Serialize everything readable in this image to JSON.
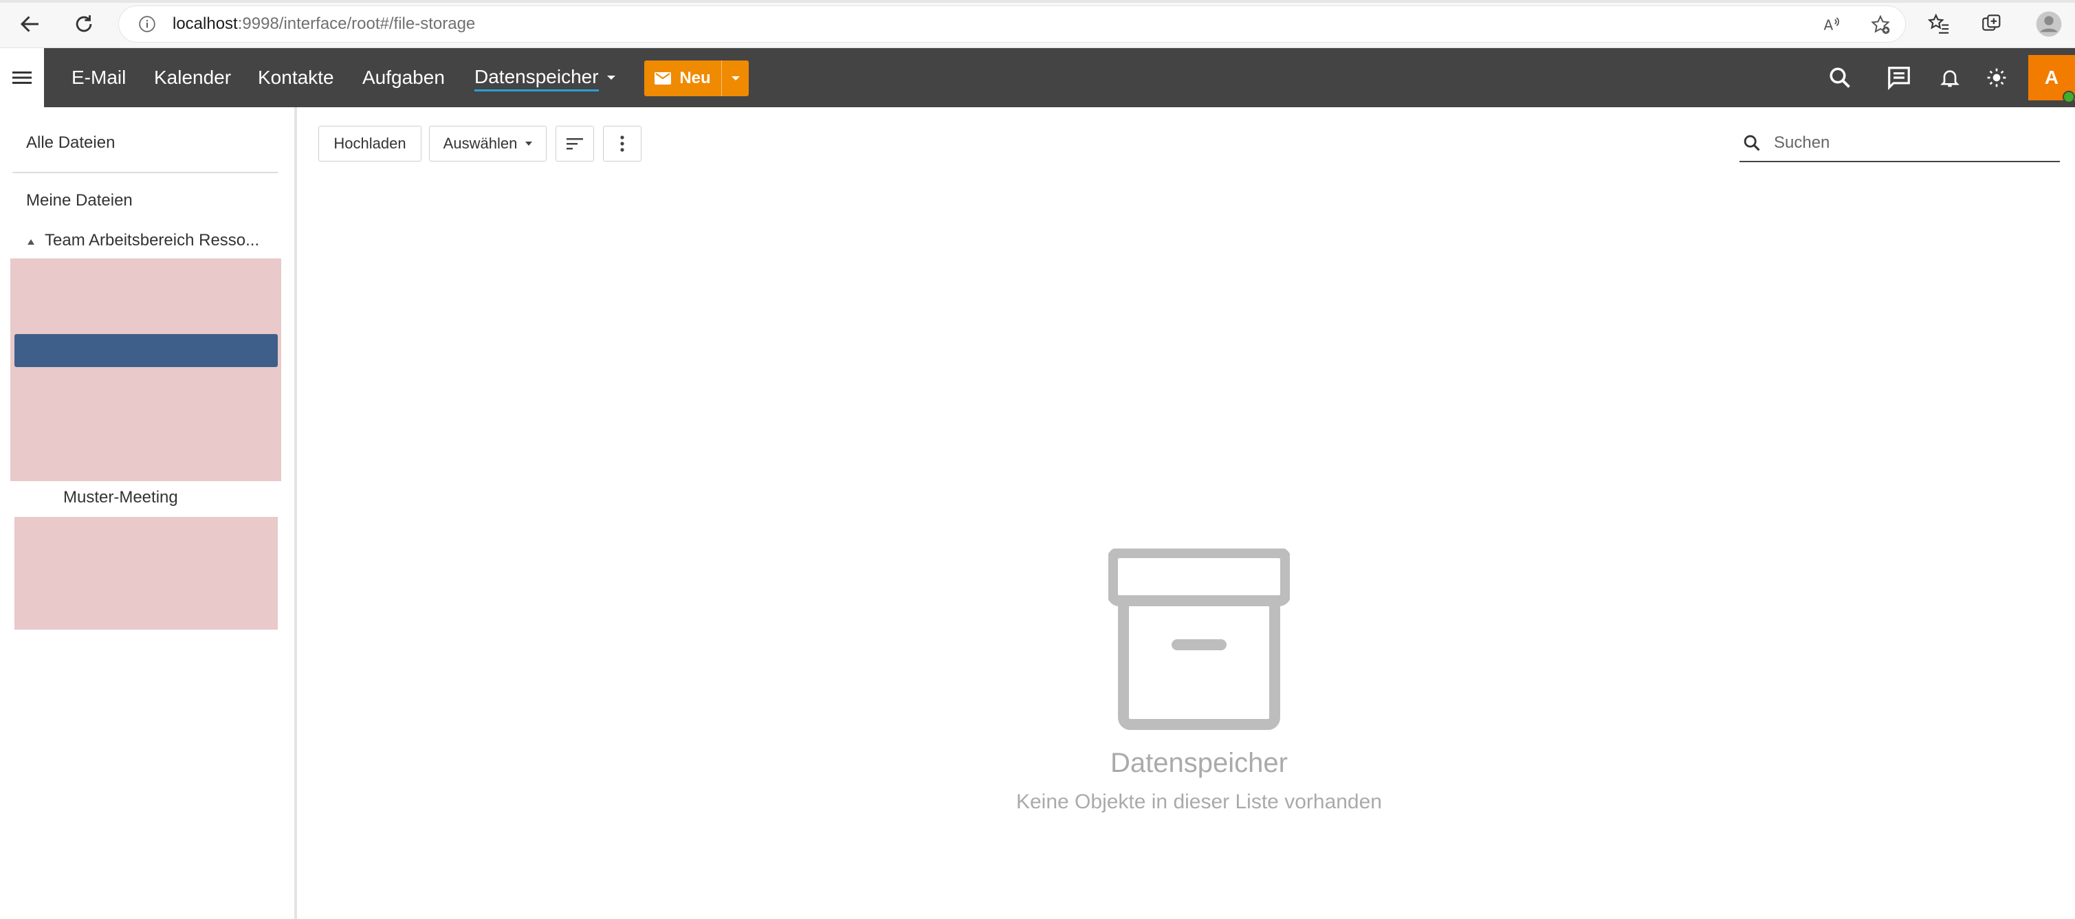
{
  "browser": {
    "url_host": "localhost",
    "url_rest": ":9998/interface/root#/file-storage"
  },
  "nav": {
    "items": [
      "E-Mail",
      "Kalender",
      "Kontakte",
      "Aufgaben"
    ],
    "active": "Datenspeicher",
    "new_label": "Neu",
    "avatar_initial": "A",
    "accent": "#f08a00",
    "bar_color": "#444444"
  },
  "sidebar": {
    "all_files": "Alle Dateien",
    "my_files": "Meine Dateien",
    "team_folder": "Team Arbeitsbereich Resso...",
    "meeting": "Muster-Meeting"
  },
  "toolbar": {
    "upload": "Hochladen",
    "select": "Auswählen",
    "search_placeholder": "Suchen"
  },
  "empty": {
    "title": "Datenspeicher",
    "subtitle": "Keine Objekte in dieser Liste vorhanden"
  }
}
